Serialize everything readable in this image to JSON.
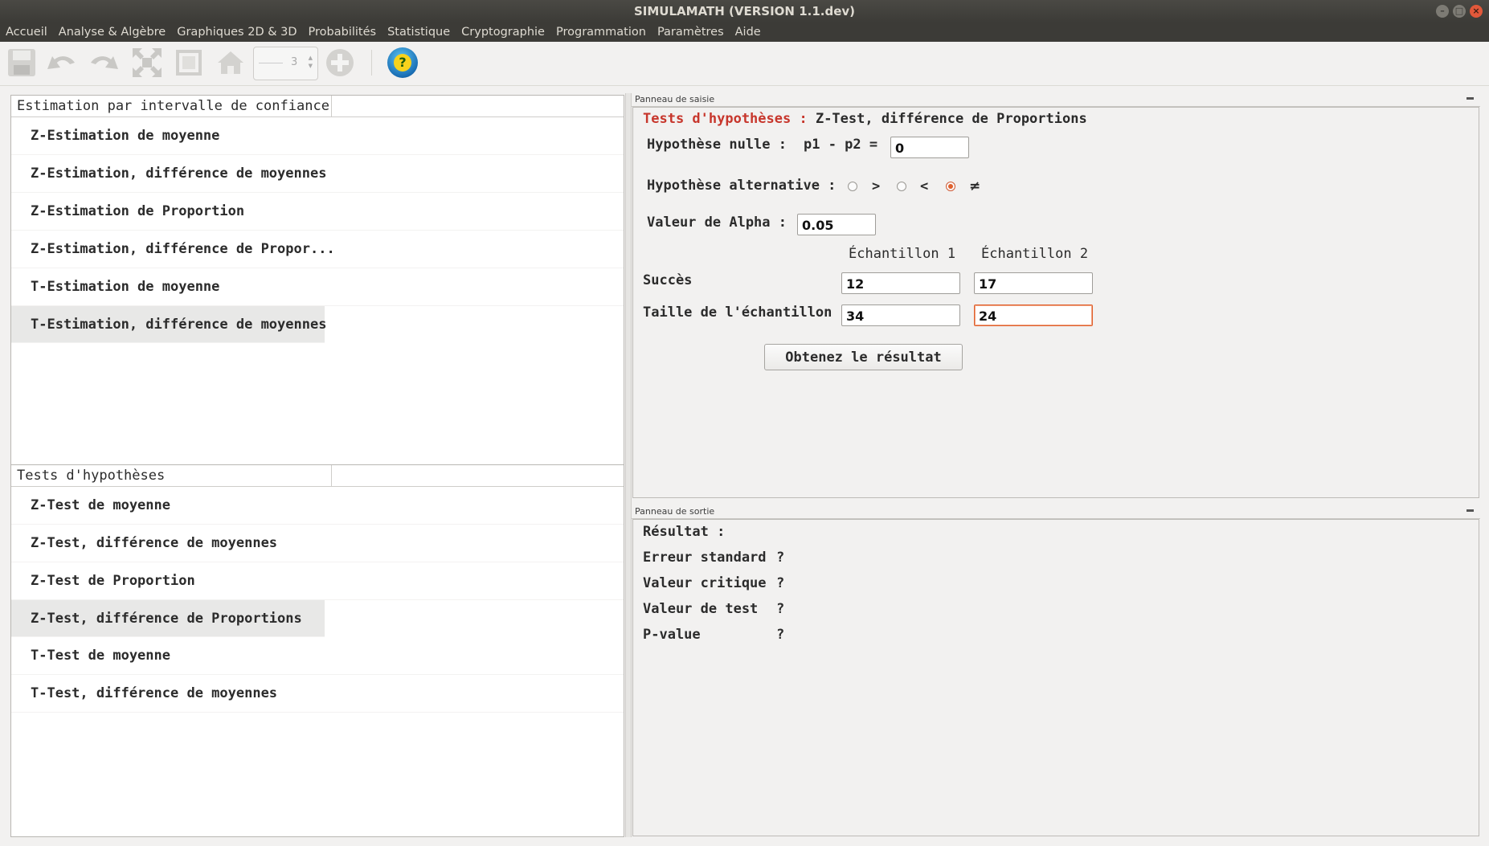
{
  "window": {
    "title": "SIMULAMATH   (VERSION 1.1.dev)"
  },
  "menu": [
    "Accueil",
    "Analyse & Algèbre",
    "Graphiques 2D & 3D",
    "Probabilités",
    "Statistique",
    "Cryptographie",
    "Programmation",
    "Paramètres",
    "Aide"
  ],
  "toolbar": {
    "spinner_value": "3"
  },
  "estimation": {
    "header": "Estimation par intervalle de confiance",
    "items": [
      "Z-Estimation de moyenne",
      "Z-Estimation, différence de moyennes",
      "Z-Estimation de Proportion",
      "Z-Estimation, différence de Propor...",
      "T-Estimation de moyenne",
      "T-Estimation, différence de moyennes"
    ]
  },
  "tests": {
    "header": "Tests d'hypothèses",
    "items": [
      "Z-Test de moyenne",
      "Z-Test, différence de moyennes",
      "Z-Test de Proportion",
      "Z-Test, différence de Proportions",
      "T-Test de moyenne",
      "T-Test, différence de moyennes"
    ]
  },
  "input_panel": {
    "title": "Panneau de saisie",
    "heading_red": "Tests d'hypothèses :",
    "heading_rest": "Z-Test, différence de Proportions",
    "null_label": "Hypothèse nulle :",
    "null_expr": "p1 - p2 =",
    "null_value": "0",
    "alt_label": "Hypothèse alternative :",
    "alt_options": [
      ">",
      "<",
      "≠"
    ],
    "alt_selected": "≠",
    "alpha_label": "Valeur de Alpha :",
    "alpha_value": "0.05",
    "col1": "Échantillon 1",
    "col2": "Échantillon 2",
    "success_label": "Succès",
    "size_label": "Taille de l'échantillon",
    "success1": "12",
    "success2": "17",
    "size1": "34",
    "size2": "24",
    "button": "Obtenez le résultat"
  },
  "output_panel": {
    "title": "Panneau de sortie",
    "result_label": "Résultat :",
    "rows": [
      {
        "label": "Erreur standard",
        "value": "?"
      },
      {
        "label": "Valeur critique",
        "value": "?"
      },
      {
        "label": "Valeur de test",
        "value": "?"
      },
      {
        "label": "P-value",
        "value": "?"
      }
    ]
  },
  "colors": {
    "accent_red": "#c7362c",
    "focus_orange": "#e0612e",
    "titlebar": "#3c3b37"
  }
}
